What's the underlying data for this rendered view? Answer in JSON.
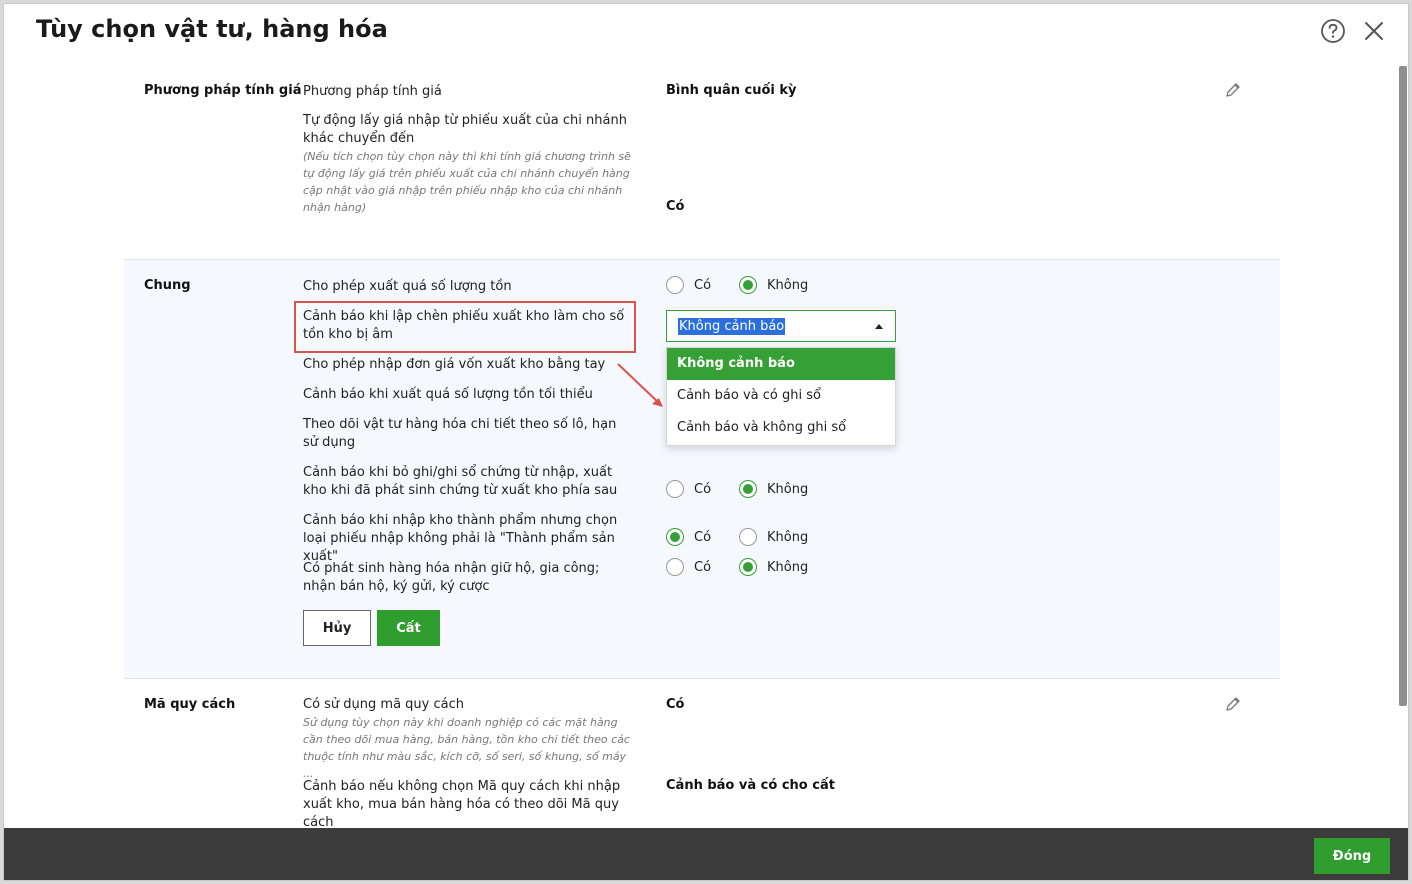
{
  "dialog": {
    "title": "Tùy chọn vật tư, hàng hóa",
    "help_icon": "question-circle-icon",
    "close_icon": "close-icon"
  },
  "pricing": {
    "section_label": "Phương pháp tính giá",
    "option1_label": "Phương pháp tính giá",
    "option1_value": "Bình quân cuối kỳ",
    "option2_label": "Tự động lấy giá nhập từ phiếu xuất của chi nhánh khác chuyển đến",
    "option2_note": "(Nếu tích chọn tùy chọn này thì khi tính giá chương trình sẽ tự động lấy giá trên phiếu xuất của chi nhánh chuyển hàng cập nhật vào giá nhập trên phiếu nhập kho của chi nhánh nhận hàng)",
    "option2_value": "Có"
  },
  "chung": {
    "section_label": "Chung",
    "yes": "Có",
    "no": "Không",
    "rows": [
      {
        "label": "Cho phép xuất quá số lượng tồn"
      },
      {
        "label": "Cảnh báo khi lập chèn phiếu xuất kho làm cho số tồn kho bị âm"
      },
      {
        "label": "Cho phép nhập đơn giá vốn xuất kho bằng tay"
      },
      {
        "label": "Cảnh báo khi xuất quá số lượng tồn tối thiểu"
      },
      {
        "label": "Theo dõi vật tư hàng hóa chi tiết theo số lô, hạn sử dụng"
      },
      {
        "label": "Cảnh báo khi bỏ ghi/ghi sổ chứng từ nhập, xuất kho khi đã phát sinh chứng từ xuất kho phía sau"
      },
      {
        "label": "Cảnh báo khi nhập kho thành phẩm nhưng chọn loại phiếu nhập không phải là \"Thành phẩm sản xuất\""
      },
      {
        "label": "Có phát sinh hàng hóa nhận giữ hộ, gia công; nhận bán hộ, ký gửi, ký cược"
      }
    ],
    "select": {
      "value": "Không cảnh báo",
      "options": [
        "Không cảnh báo",
        "Cảnh báo và có ghi sổ",
        "Cảnh báo và không ghi sổ"
      ]
    },
    "cancel_label": "Hủy",
    "save_label": "Cất"
  },
  "spec": {
    "section_label": "Mã quy cách",
    "option1_label": "Có sử dụng mã quy cách",
    "option1_note": "Sử dụng tùy chọn này khi doanh nghiệp có các mặt hàng cần theo dõi mua hàng, bán hàng, tồn kho chi tiết theo các thuộc tính như màu sắc, kích cỡ, số seri, số khung, số máy ...",
    "option1_value": "Có",
    "option2_label": "Cảnh báo nếu không chọn Mã quy cách khi nhập xuất kho, mua bán hàng hóa có theo dõi Mã quy cách",
    "option2_value": "Cảnh báo và có cho cất"
  },
  "footer": {
    "close_label": "Đóng"
  },
  "colors": {
    "accent_green": "#35a035",
    "highlight_red": "#d9534f",
    "footer_bg": "#3c3c3c"
  }
}
